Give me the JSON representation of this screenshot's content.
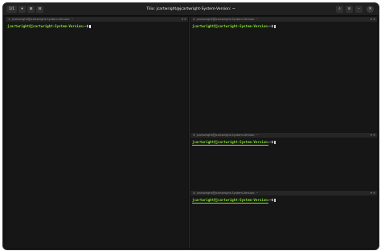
{
  "headerbar": {
    "tab_counter": "1/1",
    "title": "Tilix: jcartwright@jcartwright-System-Version: ~"
  },
  "panes": [
    {
      "title": "1: jcartwright@jcartwright-System-Version: ~",
      "user_host": "jcartwright@jcartwright-System-Version",
      "path": ":~$"
    },
    {
      "title": "2: jcartwright@jcartwright-System-Version: ~",
      "user_host": "jcartwright@jcartwright-System-Version",
      "path": ":~$"
    },
    {
      "title": "3: jcartwright@jcartwright-System-Version: ~",
      "user_host": "jcartwright@jcartwright-System-Version",
      "path": ":~$"
    },
    {
      "title": "4: jcartwright@jcartwright-System-Version: ~",
      "user_host": "jcartwright@jcartwright-System-Version",
      "path": ":~$"
    }
  ],
  "colors": {
    "prompt_user": "#8ae234",
    "background": "#161616",
    "titlebar": "#262626"
  }
}
